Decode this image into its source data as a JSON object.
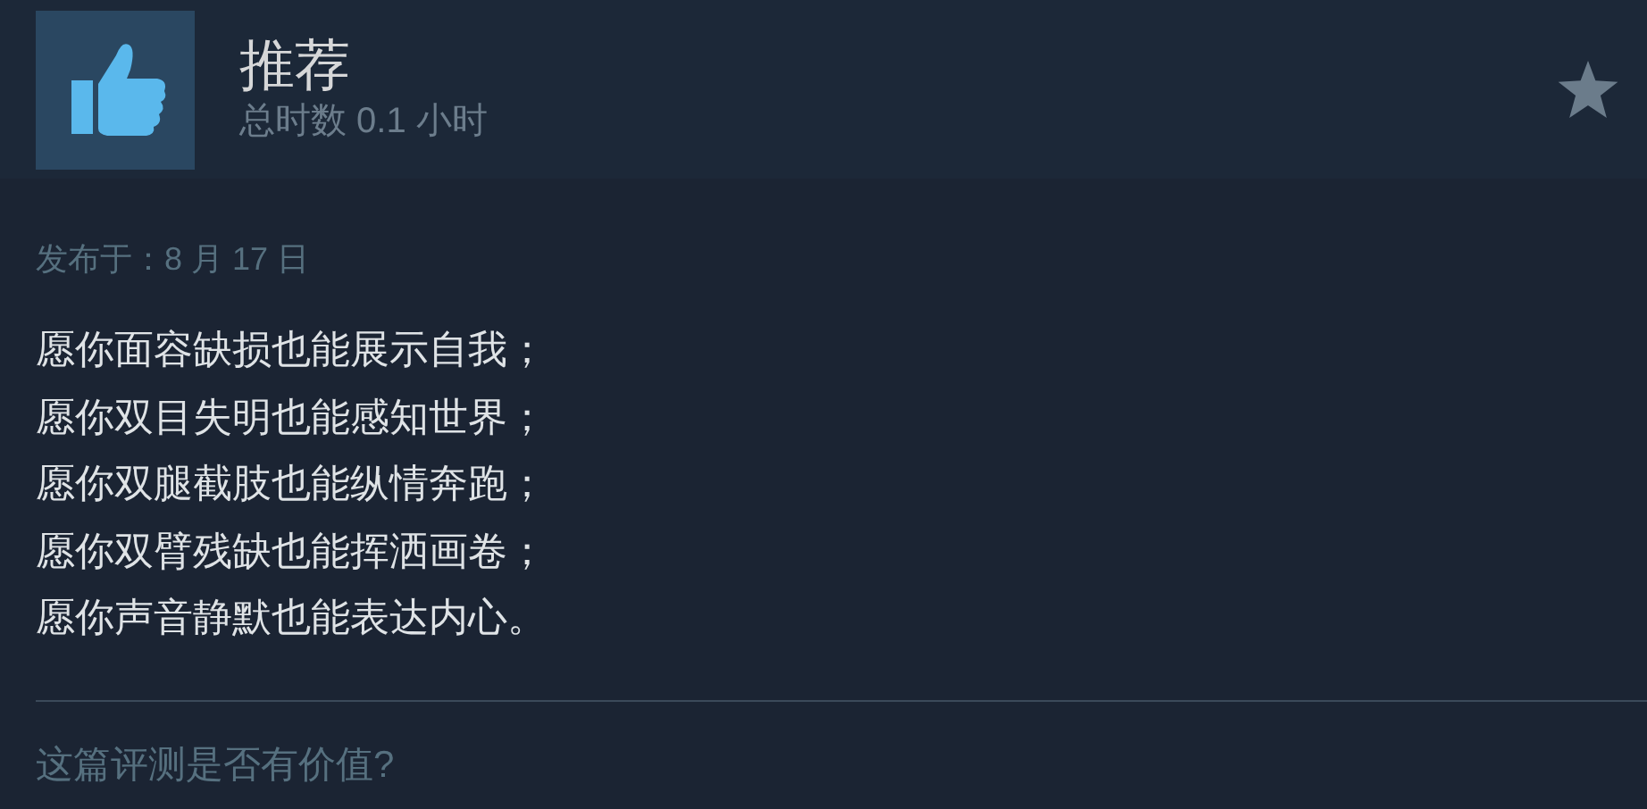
{
  "review": {
    "title": "推荐",
    "hours": "总时数 0.1 小时",
    "posted": "发布于：8 月 17 日",
    "lines": [
      "愿你面容缺损也能展示自我；",
      "愿你双目失明也能感知世界；",
      "愿你双腿截肢也能纵情奔跑；",
      "愿你双臂残缺也能挥洒画卷；",
      "愿你声音静默也能表达内心。"
    ],
    "helpful_prompt": "这篇评测是否有价值?"
  }
}
